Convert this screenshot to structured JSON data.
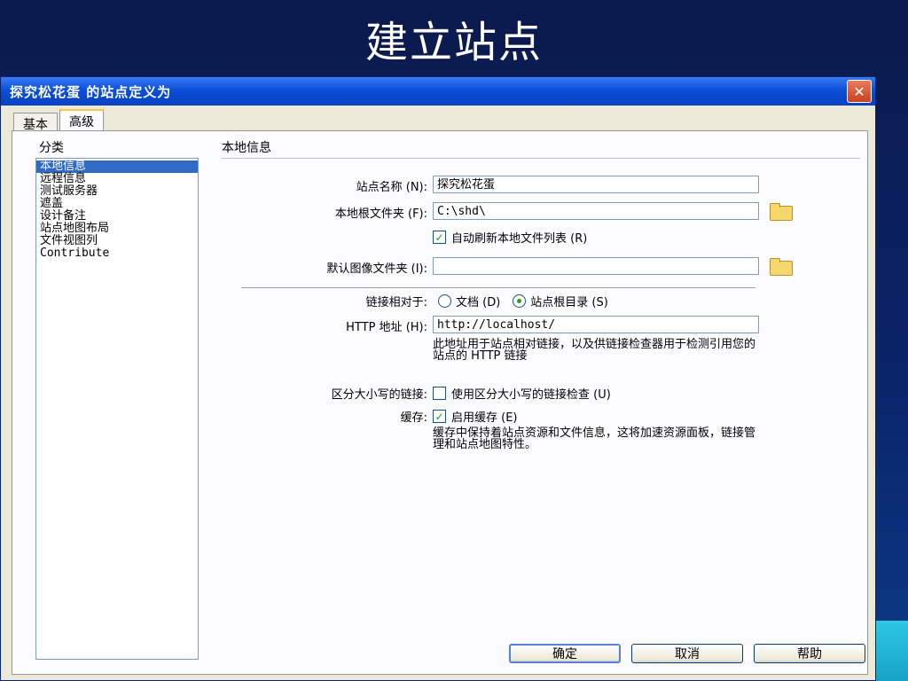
{
  "slide": {
    "title": "建立站点"
  },
  "dialog": {
    "title": "探究松花蛋 的站点定义为",
    "tabs": [
      "基本",
      "高级"
    ],
    "active_tab": "高级",
    "buttons": {
      "ok": "确定",
      "cancel": "取消",
      "help": "帮助"
    }
  },
  "categories": {
    "label": "分类",
    "items": [
      "本地信息",
      "远程信息",
      "测试服务器",
      "遮盖",
      "设计备注",
      "站点地图布局",
      "文件视图列",
      "Contribute"
    ],
    "selected": "本地信息"
  },
  "local_info": {
    "section_title": "本地信息",
    "site_name_label": "站点名称 (N):",
    "site_name_value": "探究松花蛋",
    "root_folder_label": "本地根文件夹 (F):",
    "root_folder_value": "C:\\shd\\",
    "auto_refresh_label": "自动刷新本地文件列表 (R)",
    "auto_refresh_checked": true,
    "images_folder_label": "默认图像文件夹 (I):",
    "images_folder_value": "",
    "links_relative_label": "链接相对于:",
    "radio_document": "文档 (D)",
    "radio_site_root": "站点根目录 (S)",
    "radio_selected": "站点根目录 (S)",
    "http_label": "HTTP 地址 (H):",
    "http_value": "http://localhost/",
    "http_desc": "此地址用于站点相对链接，以及供链接检查器用于检测引用您的站点的 HTTP 链接",
    "case_links_label": "区分大小写的链接:",
    "case_links_check": "使用区分大小写的链接检查 (U)",
    "case_links_checked": false,
    "cache_label": "缓存:",
    "cache_check": "启用缓存 (E)",
    "cache_checked": true,
    "cache_desc": "缓存中保持着站点资源和文件信息，这将加速资源面板，链接管理和站点地图特性。"
  },
  "colors": {
    "slide_bg": "#0a2266",
    "titlebar": "#0a4fd8",
    "selection": "#316ac5",
    "accent": "#2ec7e6"
  },
  "icons": [
    "close-icon",
    "folder-icon",
    "checkmark-icon",
    "radio-icon"
  ]
}
